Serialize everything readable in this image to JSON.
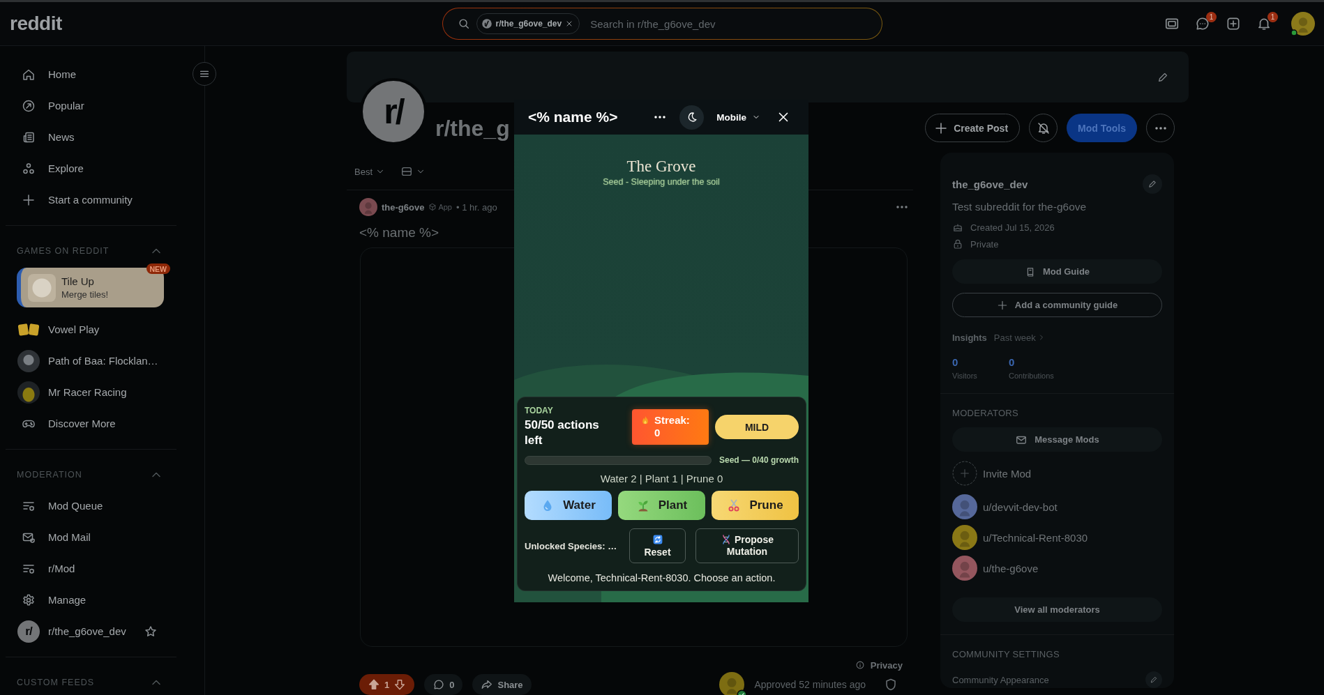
{
  "top_bar": {
    "logo": "reddit",
    "search": {
      "community_chip": "r/the_g6ove_dev",
      "placeholder": "Search in r/the_g6ove_dev"
    },
    "chat_badge": "1",
    "notifications_badge": "1",
    "user_online": true
  },
  "sidebar": {
    "nav": [
      {
        "label": "Home"
      },
      {
        "label": "Popular"
      },
      {
        "label": "News"
      },
      {
        "label": "Explore"
      },
      {
        "label": "Start a community"
      }
    ],
    "sections": [
      {
        "title": "GAMES ON REDDIT",
        "expanded": true,
        "items": [
          {
            "kind": "featured",
            "label": "Tile Up",
            "subtitle": "Merge tiles!",
            "badge": "NEW"
          },
          {
            "kind": "game",
            "label": "Vowel Play"
          },
          {
            "kind": "game",
            "label": "Path of Baa: Flocklan…"
          },
          {
            "kind": "game",
            "label": "Mr Racer Racing"
          },
          {
            "kind": "link",
            "label": "Discover More"
          }
        ]
      },
      {
        "title": "MODERATION",
        "expanded": true,
        "items": [
          {
            "kind": "link",
            "label": "Mod Queue"
          },
          {
            "kind": "link",
            "label": "Mod Mail"
          },
          {
            "kind": "link",
            "label": "r/Mod"
          },
          {
            "kind": "link",
            "label": "Manage"
          },
          {
            "kind": "community",
            "label": "r/the_g6ove_dev",
            "avatar_text": "r/",
            "favorite": false
          }
        ]
      },
      {
        "title": "CUSTOM FEEDS",
        "expanded": true
      }
    ]
  },
  "main": {
    "community": {
      "avatar_text": "r/",
      "name": "r/the_g",
      "create_post": "Create Post",
      "mod_tools": "Mod Tools"
    },
    "feed": {
      "sort": "Best",
      "post": {
        "author": "the-g6ove",
        "author_tag": "App",
        "meta": "• 1 hr. ago",
        "title": "<% name %>",
        "privacy": "Privacy",
        "vote": {
          "score": "1",
          "upvoted": true
        },
        "comments": "0",
        "share": "Share",
        "approval": "Approved 52 minutes ago"
      }
    }
  },
  "right_sidebar": {
    "about": {
      "name": "the_g6ove_dev",
      "description": "Test subreddit for the-g6ove",
      "created": "Created Jul 15, 2026",
      "visibility": "Private",
      "mod_guide": "Mod Guide",
      "add_guide": "Add a community guide",
      "insights": "Insights",
      "insights_range": "Past week",
      "stats": [
        {
          "value": "0",
          "label": "Visitors"
        },
        {
          "value": "0",
          "label": "Contributions"
        }
      ]
    },
    "moderators": {
      "title": "MODERATORS",
      "message": "Message Mods",
      "invite": "Invite Mod",
      "list": [
        {
          "name": "u/devvit-dev-bot",
          "color": "#56689a"
        },
        {
          "name": "u/Technical-Rent-8030",
          "color": "#8a7816"
        },
        {
          "name": "u/the-g6ove",
          "color": "#94565e"
        }
      ],
      "view_all": "View all moderators"
    },
    "community_settings": {
      "title": "COMMUNITY SETTINGS",
      "items": [
        {
          "label": "Community Appearance"
        }
      ]
    }
  },
  "app_preview": {
    "title": "<% name %>",
    "view_mode": "Mobile",
    "game": {
      "title": "The Grove",
      "subtitle": "Seed - Sleeping under the soil",
      "today_label": "TODAY",
      "actions_left": "50/50 actions left",
      "streak": "Streak: 0",
      "difficulty": "MILD",
      "growth": {
        "level": 0,
        "label": "Seed — 0/40 growth"
      },
      "counts": "Water 2 | Plant 1 | Prune 0",
      "actions": [
        {
          "kind": "water",
          "label": "Water"
        },
        {
          "kind": "plant",
          "label": "Plant"
        },
        {
          "kind": "prune",
          "label": "Prune"
        }
      ],
      "unlocked": "Unlocked Species: …",
      "reset": "Reset",
      "propose": "Propose Mutation",
      "message": "Welcome, Technical-Rent-8030. Choose an action."
    }
  }
}
